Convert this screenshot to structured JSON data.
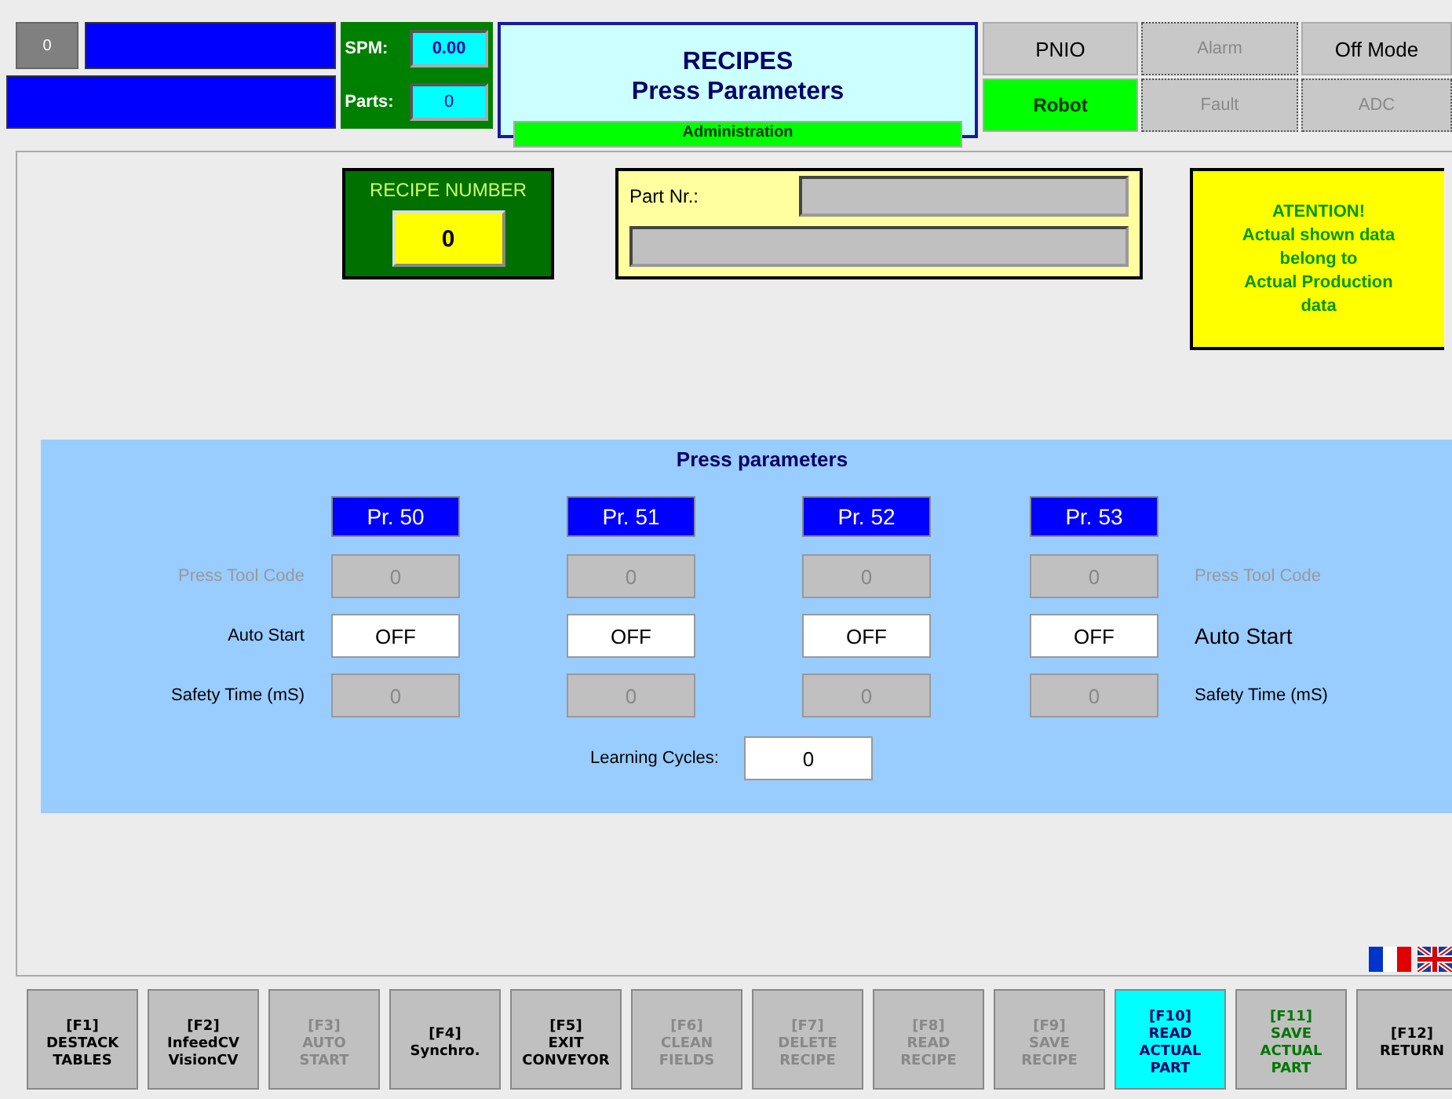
{
  "header": {
    "counter": "0",
    "spm": {
      "label": "SPM:",
      "value": "0.00"
    },
    "parts": {
      "label": "Parts:",
      "value": "0"
    },
    "title": "RECIPES",
    "subtitle": "Press Parameters",
    "user": "Administration",
    "indicators": [
      {
        "label": "PNIO",
        "on": false,
        "disabled": false
      },
      {
        "label": "Alarm",
        "on": false,
        "disabled": true
      },
      {
        "label": "Off Mode",
        "on": false,
        "disabled": false
      },
      {
        "label": "Robot",
        "on": true,
        "disabled": false
      },
      {
        "label": "Fault",
        "on": false,
        "disabled": true
      },
      {
        "label": "ADC",
        "on": false,
        "disabled": true
      }
    ]
  },
  "recipe": {
    "label": "RECIPE NUMBER",
    "value": "0"
  },
  "part": {
    "label": "Part Nr.:"
  },
  "attention": {
    "text": "ATENTION!\nActual shown data\nbelong to\nActual Production\ndata"
  },
  "press_parameters": {
    "title": "Press parameters",
    "presses": [
      "Pr. 50",
      "Pr. 51",
      "Pr. 52",
      "Pr. 53"
    ],
    "rows": [
      {
        "label": "Press Tool Code",
        "right_label": "Press Tool Code",
        "label_disabled": true,
        "disabled": true,
        "values": [
          "0",
          "0",
          "0",
          "0"
        ]
      },
      {
        "label": "Auto Start",
        "right_label": "Auto Start",
        "label_disabled": false,
        "disabled": false,
        "values": [
          "OFF",
          "OFF",
          "OFF",
          "OFF"
        ]
      },
      {
        "label": "Safety Time (mS)",
        "right_label": "Safety Time (mS)",
        "label_disabled": false,
        "disabled": true,
        "values": [
          "0",
          "0",
          "0",
          "0"
        ]
      }
    ],
    "learning_cycles": {
      "label": "Learning Cycles:",
      "value": "0"
    }
  },
  "function_keys": [
    {
      "key": "[F1]",
      "label": "DESTACK\nTABLES",
      "kind": "normal"
    },
    {
      "key": "[F2]",
      "label": "InfeedCV\nVisionCV",
      "kind": "normal"
    },
    {
      "key": "[F3]",
      "label": "AUTO\nSTART",
      "kind": "disabled"
    },
    {
      "key": "[F4]",
      "label": "Synchro.",
      "kind": "normal"
    },
    {
      "key": "[F5]",
      "label": "EXIT\nCONVEYOR",
      "kind": "normal"
    },
    {
      "key": "[F6]",
      "label": "CLEAN\nFIELDS",
      "kind": "disabled"
    },
    {
      "key": "[F7]",
      "label": "DELETE\nRECIPE",
      "kind": "disabled"
    },
    {
      "key": "[F8]",
      "label": "READ\nRECIPE",
      "kind": "disabled"
    },
    {
      "key": "[F9]",
      "label": "SAVE\nRECIPE",
      "kind": "disabled"
    },
    {
      "key": "[F10]",
      "label": "READ\nACTUAL\nPART",
      "kind": "highlight"
    },
    {
      "key": "[F11]",
      "label": "SAVE\nACTUAL\nPART",
      "kind": "accent"
    },
    {
      "key": "[F12]",
      "label": "RETURN",
      "kind": "normal"
    }
  ]
}
